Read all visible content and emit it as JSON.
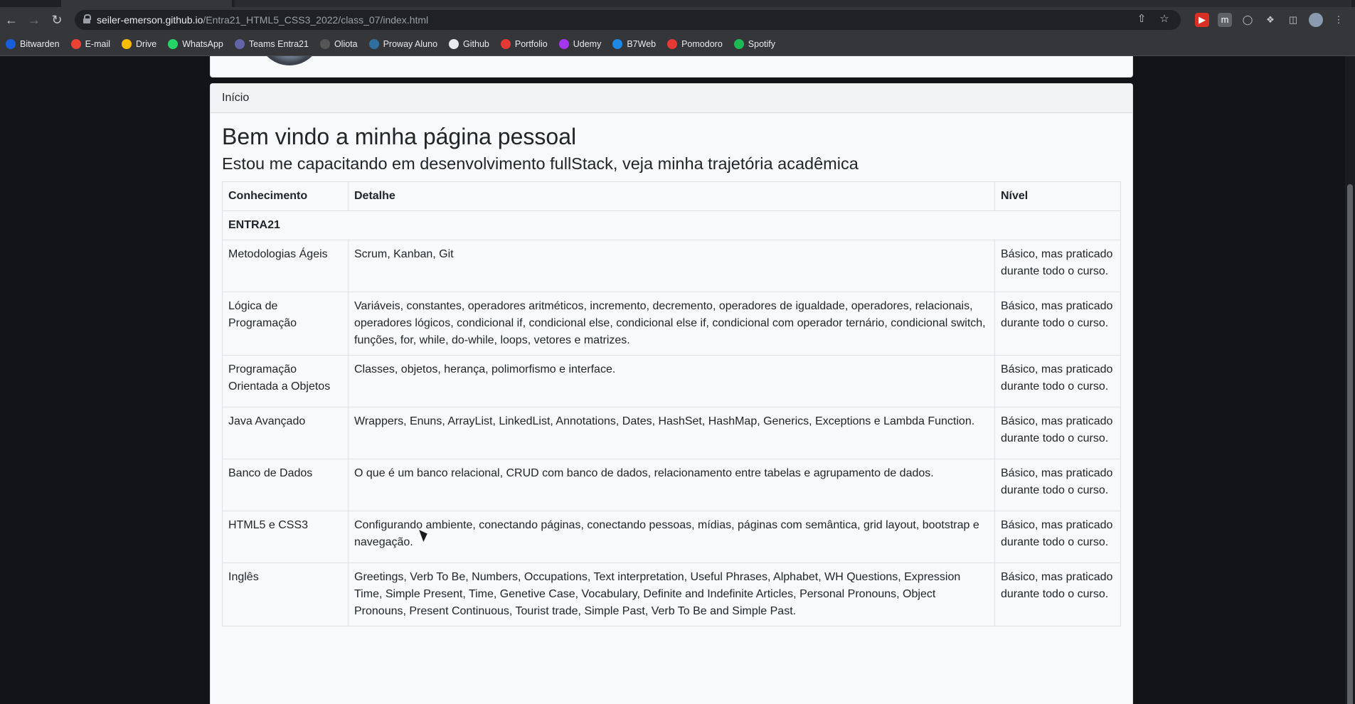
{
  "browser": {
    "url_host": "seiler-emerson.github.io",
    "url_path": "/Entra21_HTML5_CSS3_2022/class_07/index.html",
    "bookmarks": [
      {
        "label": "Bitwarden",
        "icon": "shield-icon",
        "color": "#175ddc"
      },
      {
        "label": "E-mail",
        "icon": "gmail-icon",
        "color": "#ea4335"
      },
      {
        "label": "Drive",
        "icon": "drive-icon",
        "color": "#fbbc04"
      },
      {
        "label": "WhatsApp",
        "icon": "whatsapp-icon",
        "color": "#25d366"
      },
      {
        "label": "Teams Entra21",
        "icon": "teams-icon",
        "color": "#6264a7"
      },
      {
        "label": "Oliota",
        "icon": "circle-icon",
        "color": "#555555"
      },
      {
        "label": "Proway Aluno",
        "icon": "globe-icon",
        "color": "#2f6f9f"
      },
      {
        "label": "Github",
        "icon": "github-icon",
        "color": "#e8eaed"
      },
      {
        "label": "Portfolio",
        "icon": "portfolio-icon",
        "color": "#e53935"
      },
      {
        "label": "Udemy",
        "icon": "udemy-icon",
        "color": "#a435f0"
      },
      {
        "label": "B7Web",
        "icon": "b7web-icon",
        "color": "#1e88e5"
      },
      {
        "label": "Pomodoro",
        "icon": "check-icon",
        "color": "#e53935"
      },
      {
        "label": "Spotify",
        "icon": "spotify-icon",
        "color": "#1db954"
      }
    ]
  },
  "page": {
    "breadcrumb": "Início",
    "title": "Bem vindo a minha página pessoal",
    "subtitle": "Estou me capacitando em desenvolvimento fullStack, veja minha trajetória acadêmica",
    "table": {
      "headers": [
        "Conhecimento",
        "Detalhe",
        "Nível"
      ],
      "group": "ENTRA21",
      "rows": [
        {
          "topic": "Metodologias Ágeis",
          "detail": "Scrum, Kanban, Git",
          "level": "Básico, mas praticado durante todo o curso."
        },
        {
          "topic": "Lógica de Programação",
          "detail": "Variáveis, constantes, operadores aritméticos, incremento, decremento, operadores de igualdade, operadores, relacionais, operadores lógicos, condicional if, condicional else, condicional else if, condicional com operador ternário, condicional switch, funções, for, while, do-while, loops, vetores e matrizes.",
          "level": "Básico, mas praticado durante todo o curso."
        },
        {
          "topic": "Programação Orientada a Objetos",
          "detail": "Classes, objetos, herança, polimorfismo e interface.",
          "level": "Básico, mas praticado durante todo o curso."
        },
        {
          "topic": "Java Avançado",
          "detail": "Wrappers, Enuns, ArrayList, LinkedList, Annotations, Dates, HashSet, HashMap, Generics, Exceptions e Lambda Function.",
          "level": "Básico, mas praticado durante todo o curso."
        },
        {
          "topic": "Banco de Dados",
          "detail": "O que é um banco relacional, CRUD com banco de dados, relacionamento entre tabelas e agrupamento de dados.",
          "level": "Básico, mas praticado durante todo o curso."
        },
        {
          "topic": "HTML5 e CSS3",
          "detail": "Configurando ambiente, conectando páginas, conectando pessoas, mídias, páginas com semântica, grid layout, bootstrap e navegação.",
          "level": "Básico, mas praticado durante todo o curso."
        },
        {
          "topic": "Inglês",
          "detail": "Greetings, Verb To Be, Numbers, Occupations, Text interpretation, Useful Phrases, Alphabet, WH Questions, Expression Time, Simple Present, Time, Genetive Case, Vocabulary, Definite and Indefinite Articles, Personal Pronouns, Object Pronouns, Present Continuous, Tourist trade, Simple Past, Verb To Be and Simple Past.",
          "level": "Básico, mas praticado durante todo o curso."
        }
      ]
    }
  }
}
